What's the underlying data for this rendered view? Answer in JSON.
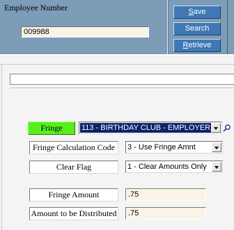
{
  "header": {
    "employee_number_label": "Employee Number",
    "employee_number_value": "009988",
    "buttons": {
      "save": {
        "accel": "S",
        "rest": "ave"
      },
      "search": {
        "accel": "S",
        "rest": "earch"
      },
      "retrieve": {
        "accel": "R",
        "rest": "etrieve"
      }
    }
  },
  "form": {
    "fringe": {
      "label": "Fringe",
      "selected": "113 - BIRTHDAY CLUB - EMPLOYER"
    },
    "calculation_code": {
      "label": "Fringe Calculation Code",
      "selected": "3 - Use Fringe Amnt"
    },
    "clear_flag": {
      "label": "Clear Flag",
      "selected": "1 - Clear Amounts Only"
    },
    "fringe_amount": {
      "label": "Fringe Amount",
      "value": ".75"
    },
    "amount_distributed": {
      "label": "Amount to be Distributed",
      "value": ".75"
    }
  },
  "colors": {
    "header_band": "#7c9cb8",
    "button_blue": "#3f78b4",
    "fringe_green": "#55ef1c",
    "selection_blue": "#0a246a",
    "amount_field": "#fbf4e6"
  },
  "icons": {
    "lookup": "magnifier-icon",
    "dropdown": "chevron-down-icon"
  }
}
